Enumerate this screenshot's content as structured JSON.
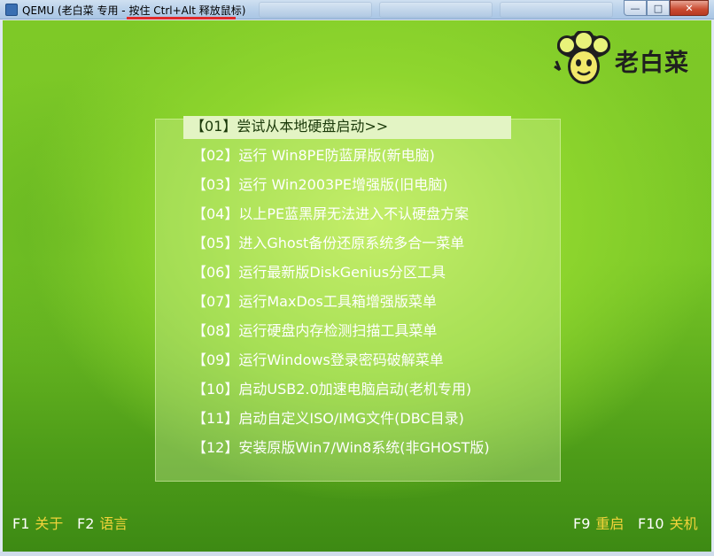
{
  "window": {
    "title_app": "QEMU (老白菜 专用 ",
    "title_hint": "- 按住 Ctrl+Alt 释放鼠标)",
    "controls": {
      "minimize": "—",
      "maximize": "□",
      "close": "✕"
    }
  },
  "logo": {
    "text": "老白菜",
    "icon": "cabbage-mascot-icon"
  },
  "menu": {
    "items": [
      {
        "label": "【01】尝试从本地硬盘启动>>",
        "selected": true
      },
      {
        "label": "【02】运行 Win8PE防蓝屏版(新电脑)"
      },
      {
        "label": "【03】运行 Win2003PE增强版(旧电脑)"
      },
      {
        "label": "【04】以上PE蓝黑屏无法进入不认硬盘方案"
      },
      {
        "label": "【05】进入Ghost备份还原系统多合一菜单"
      },
      {
        "label": "【06】运行最新版DiskGenius分区工具"
      },
      {
        "label": "【07】运行MaxDos工具箱增强版菜单"
      },
      {
        "label": "【08】运行硬盘内存检测扫描工具菜单"
      },
      {
        "label": "【09】运行Windows登录密码破解菜单"
      },
      {
        "label": "【10】启动USB2.0加速电脑启动(老机专用)"
      },
      {
        "label": "【11】启动自定义ISO/IMG文件(DBC目录)"
      },
      {
        "label": "【12】安装原版Win7/Win8系统(非GHOST版)"
      }
    ]
  },
  "fkeys": {
    "f1": {
      "key": "F1",
      "label": "关于"
    },
    "f2": {
      "key": "F2",
      "label": "语言"
    },
    "f9": {
      "key": "F9",
      "label": "重启"
    },
    "f10": {
      "key": "F10",
      "label": "关机"
    }
  },
  "colors": {
    "background_green": "#8fd62e",
    "selection_bar": "#e3f4c4",
    "fkey_label": "#f1d33a",
    "title_underline": "#e02a2a"
  }
}
